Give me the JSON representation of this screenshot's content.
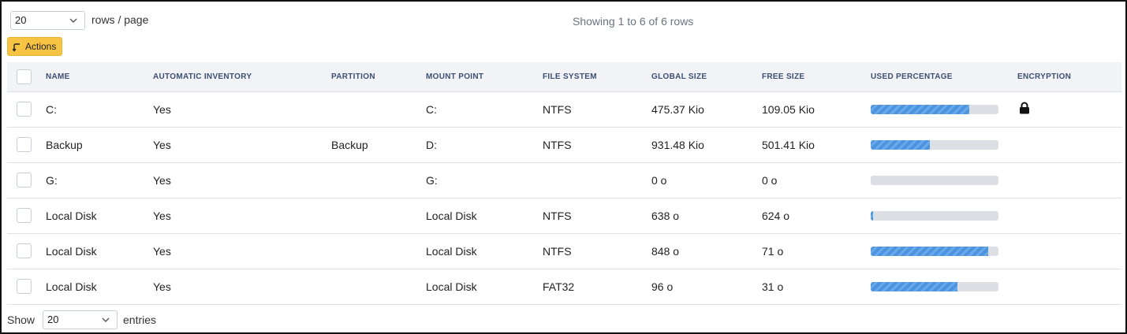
{
  "top": {
    "page_size_value": "20",
    "rows_per_page_label": "rows / page",
    "showing_text": "Showing 1 to 6 of 6 rows",
    "actions_label": "Actions"
  },
  "table": {
    "headers": {
      "name": "NAME",
      "automatic_inventory": "AUTOMATIC INVENTORY",
      "partition": "PARTITION",
      "mount_point": "MOUNT POINT",
      "file_system": "FILE SYSTEM",
      "global_size": "GLOBAL SIZE",
      "free_size": "FREE SIZE",
      "used_percentage": "USED PERCENTAGE",
      "encryption": "ENCRYPTION"
    },
    "rows": [
      {
        "name": "C:",
        "auto": "Yes",
        "partition": "",
        "mount": "C:",
        "fs": "NTFS",
        "global": "475.37 Kio",
        "free": "109.05 Kio",
        "used_pct": 77,
        "encrypted": true
      },
      {
        "name": "Backup",
        "auto": "Yes",
        "partition": "Backup",
        "mount": "D:",
        "fs": "NTFS",
        "global": "931.48 Kio",
        "free": "501.41 Kio",
        "used_pct": 46,
        "encrypted": false
      },
      {
        "name": "G:",
        "auto": "Yes",
        "partition": "",
        "mount": "G:",
        "fs": "",
        "global": "0 o",
        "free": "0 o",
        "used_pct": 0,
        "encrypted": false
      },
      {
        "name": "Local Disk",
        "auto": "Yes",
        "partition": "",
        "mount": "Local Disk",
        "fs": "NTFS",
        "global": "638 o",
        "free": "624 o",
        "used_pct": 2,
        "encrypted": false
      },
      {
        "name": "Local Disk",
        "auto": "Yes",
        "partition": "",
        "mount": "Local Disk",
        "fs": "NTFS",
        "global": "848 o",
        "free": "71 o",
        "used_pct": 92,
        "encrypted": false
      },
      {
        "name": "Local Disk",
        "auto": "Yes",
        "partition": "",
        "mount": "Local Disk",
        "fs": "FAT32",
        "global": "96 o",
        "free": "31 o",
        "used_pct": 68,
        "encrypted": false
      }
    ]
  },
  "bottom": {
    "show_label": "Show",
    "page_size_value": "20",
    "entries_label": "entries"
  },
  "icons": {
    "chevron": "chevron-down-icon",
    "actions": "corner-down-left-icon",
    "lock": "lock-icon"
  },
  "colors": {
    "accent_button": "#f6c343",
    "link": "#3d5a94",
    "header_text": "#3d4f74",
    "bar_fill": "#4d94e0",
    "bar_track": "#dcdfe4"
  }
}
